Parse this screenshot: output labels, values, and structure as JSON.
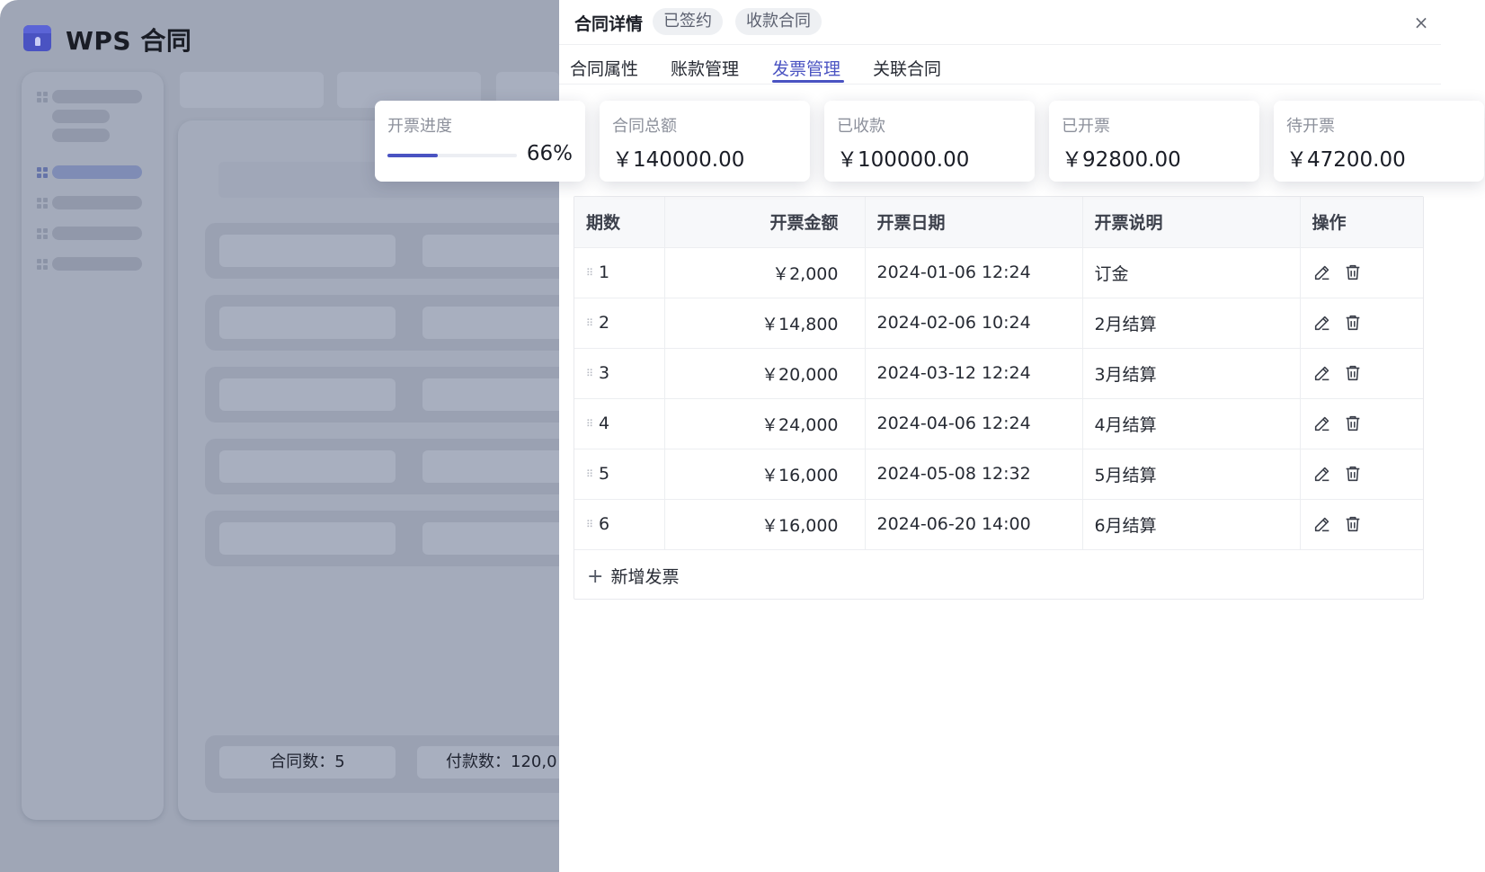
{
  "app": {
    "title": "WPS 合同",
    "footer": {
      "contract_count": "合同数：5",
      "payment_count": "付款数：120,0"
    }
  },
  "drawer": {
    "title": "合同详情",
    "tags": [
      "已签约",
      "收款合同"
    ],
    "close_icon": "×",
    "tabs": [
      {
        "label": "合同属性",
        "active": false
      },
      {
        "label": "账款管理",
        "active": false
      },
      {
        "label": "发票管理",
        "active": true
      },
      {
        "label": "关联合同",
        "active": false
      }
    ]
  },
  "stats": {
    "progress": {
      "label": "开票进度",
      "percent_text": "66%",
      "percent": 0.66
    },
    "cards": [
      {
        "label": "合同总额",
        "value": "￥140000.00"
      },
      {
        "label": "已收款",
        "value": "￥100000.00"
      },
      {
        "label": "已开票",
        "value": "￥92800.00"
      },
      {
        "label": "待开票",
        "value": "￥47200.00"
      }
    ]
  },
  "table": {
    "headers": [
      "期数",
      "开票金额",
      "开票日期",
      "开票说明",
      "操作"
    ],
    "rows": [
      {
        "period": "1",
        "amount": "￥2,000",
        "date": "2024-01-06 12:24",
        "note": "订金"
      },
      {
        "period": "2",
        "amount": "￥14,800",
        "date": "2024-02-06 10:24",
        "note": "2月结算"
      },
      {
        "period": "3",
        "amount": "￥20,000",
        "date": "2024-03-12 12:24",
        "note": "3月结算"
      },
      {
        "period": "4",
        "amount": "￥24,000",
        "date": "2024-04-06 12:24",
        "note": "4月结算"
      },
      {
        "period": "5",
        "amount": "￥16,000",
        "date": "2024-05-08 12:32",
        "note": "5月结算"
      },
      {
        "period": "6",
        "amount": "￥16,000",
        "date": "2024-06-20 14:00",
        "note": "6月结算"
      }
    ],
    "add_label": "新增发票",
    "icons": {
      "edit": "pencil-icon",
      "delete": "trash-icon",
      "drag": "drag-handle-icon"
    }
  },
  "colors": {
    "accent": "#4a53c2",
    "overlay": "#9fa6b6"
  }
}
